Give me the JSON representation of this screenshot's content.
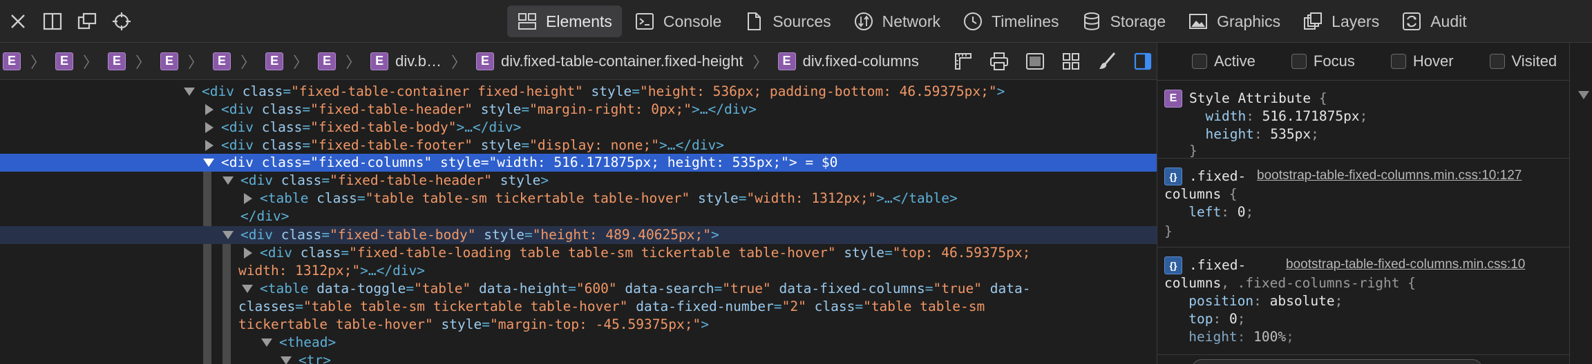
{
  "tabs": [
    {
      "label": "Elements",
      "icon": "elements-icon",
      "active": true
    },
    {
      "label": "Console",
      "icon": "console-icon"
    },
    {
      "label": "Sources",
      "icon": "sources-icon"
    },
    {
      "label": "Network",
      "icon": "network-icon"
    },
    {
      "label": "Timelines",
      "icon": "timelines-icon"
    },
    {
      "label": "Storage",
      "icon": "storage-icon"
    },
    {
      "label": "Graphics",
      "icon": "graphics-icon"
    },
    {
      "label": "Layers",
      "icon": "layers-icon"
    },
    {
      "label": "Audit",
      "icon": "audit-icon"
    }
  ],
  "breadcrumb": {
    "badge": "E",
    "items": [
      "",
      "",
      "",
      "",
      "",
      "",
      "",
      "div.b…",
      "div.fixed-table-container.fixed-height",
      "div.fixed-columns"
    ]
  },
  "dom": {
    "l1": {
      "t1": "<div ",
      "a1": "class",
      "v1": "\"fixed-table-container fixed-height\"",
      "a2": "style",
      "v2": "\"height: 536px; padding-bottom: 46.59375px;\"",
      "t2": ">"
    },
    "l2": {
      "t1": "<div ",
      "a1": "class",
      "v1": "\"fixed-table-header\"",
      "a2": "style",
      "v2": "\"margin-right: 0px;\"",
      "t2": ">…</div>"
    },
    "l3": {
      "t1": "<div ",
      "a1": "class",
      "v1": "\"fixed-table-body\"",
      "t2": ">…</div>"
    },
    "l4": {
      "t1": "<div ",
      "a1": "class",
      "v1": "\"fixed-table-footer\"",
      "a2": "style",
      "v2": "\"display: none;\"",
      "t2": ">…</div>"
    },
    "l5": {
      "t1": "<div ",
      "a1": "class",
      "v1": "\"fixed-columns\"",
      "a2": "style",
      "v2": "\"width: 516.171875px; height: 535px;\"",
      "t2": ">",
      "suffix": " = $0"
    },
    "l6": {
      "t1": "<div ",
      "a1": "class",
      "v1": "\"fixed-table-header\"",
      "a2": "style",
      "t2": ">"
    },
    "l7": {
      "t1": "<table ",
      "a1": "class",
      "v1": "\"table table-sm tickertable table-hover\"",
      "a2": "style",
      "v2": "\"width: 1312px;\"",
      "t2": ">…</table>"
    },
    "l8": {
      "t1": "</div>"
    },
    "l9": {
      "t1": "<div ",
      "a1": "class",
      "v1": "\"fixed-table-body\"",
      "a2": "style",
      "v2": "\"height: 489.40625px;\"",
      "t2": ">"
    },
    "l10": {
      "t1": "<div ",
      "a1": "class",
      "v1": "\"fixed-table-loading table table-sm tickertable table-hover\"",
      "a2": "style",
      "v2": "\"top: 46.59375px;"
    },
    "l11": {
      "v1": "width: 1312px;\"",
      "t2": ">…</div>"
    },
    "l12": {
      "t1": "<table ",
      "a1": "data-toggle",
      "v1": "\"table\"",
      "a2": "data-height",
      "v2": "\"600\"",
      "a3": "data-search",
      "v3": "\"true\"",
      "a4": "data-fixed-columns",
      "v4": "\"true\"",
      "a5": "data-"
    },
    "l13": {
      "a1": "classes",
      "v1": "\"table table-sm tickertable table-hover\"",
      "a2": "data-fixed-number",
      "v2": "\"2\"",
      "a3": "class",
      "v3": "\"table table-sm"
    },
    "l14": {
      "v1": "tickertable table-hover\"",
      "a2": "style",
      "v2": "\"margin-top: -45.59375px;\"",
      "t2": ">"
    },
    "l15": {
      "t1": "<thead>"
    },
    "l16": {
      "t1": "<tr>"
    }
  },
  "styles": {
    "pseudo": [
      "Active",
      "Focus",
      "Hover",
      "Visited"
    ],
    "rule1": {
      "badge": "E",
      "selector": "Style Attribute",
      "open": " {",
      "props": [
        {
          "name": "width",
          "value": "516.171875px"
        },
        {
          "name": "height",
          "value": "535px"
        }
      ],
      "close": "}"
    },
    "rule2": {
      "badge": "{}",
      "sel1": ".fixed-",
      "sel2": "columns",
      "open": " {",
      "source": "bootstrap-table-fixed-columns.min.css:10:127",
      "props": [
        {
          "name": "left",
          "value": "0"
        }
      ],
      "close": "}"
    },
    "rule3": {
      "badge": "{}",
      "sel1": ".fixed-",
      "sel2": "columns",
      "sel3": ", .fixed-columns-right",
      "open": " {",
      "source": "bootstrap-table-fixed-columns.min.css:10",
      "props": [
        {
          "name": "position",
          "value": "absolute"
        },
        {
          "name": "top",
          "value": "0"
        },
        {
          "name": "height",
          "value": "100%"
        }
      ]
    }
  }
}
